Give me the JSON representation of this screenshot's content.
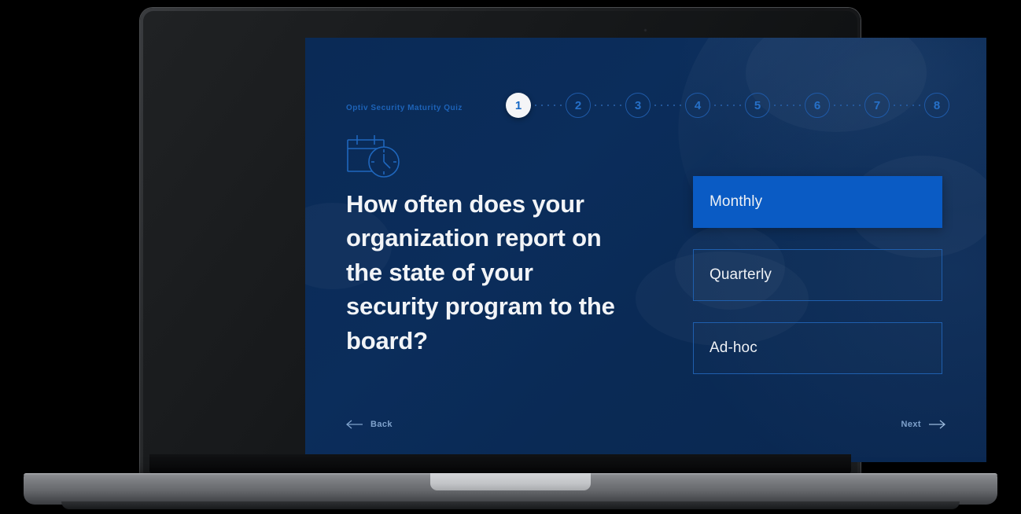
{
  "brand": {
    "quiz_label": "Optiv Security Maturity Quiz",
    "accent_blue": "#0a5bc4",
    "background_navy": "#0a2a56",
    "outline_blue": "#1f5fae",
    "label_blue": "#1d63b8"
  },
  "stepper": {
    "current_step": 1,
    "total_steps": 8,
    "steps": [
      {
        "number": "1",
        "state": "active"
      },
      {
        "number": "2",
        "state": "idle"
      },
      {
        "number": "3",
        "state": "idle"
      },
      {
        "number": "4",
        "state": "idle"
      },
      {
        "number": "5",
        "state": "idle"
      },
      {
        "number": "6",
        "state": "idle"
      },
      {
        "number": "7",
        "state": "idle"
      },
      {
        "number": "8",
        "state": "idle"
      }
    ]
  },
  "question": {
    "icon": "calendar-clock-icon",
    "text": "How often does your organization report on the state of your security program to the board?"
  },
  "answers": [
    {
      "label": "Monthly",
      "selected": true
    },
    {
      "label": "Quarterly",
      "selected": false
    },
    {
      "label": "Ad-hoc",
      "selected": false
    }
  ],
  "navigation": {
    "back_label": "Back",
    "back_icon": "arrow-left-icon",
    "next_label": "Next",
    "next_icon": "arrow-right-icon"
  },
  "device": {
    "type": "laptop",
    "camera": "webcam-dot"
  }
}
